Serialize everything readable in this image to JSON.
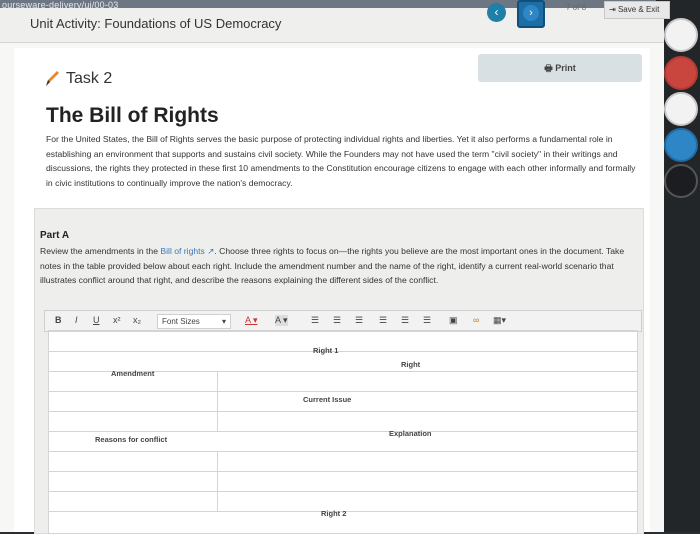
{
  "browser": {
    "strip_text": "ourseware-delivery/ui/00-03"
  },
  "header": {
    "unit_title": "Unit Activity: Foundations of US Democracy",
    "page_count": "7 of 8",
    "save_exit": "Save & Exit"
  },
  "task": {
    "label": "Task 2",
    "print_label": "Print",
    "title": "The Bill of Rights",
    "intro": "For the United States, the Bill of Rights serves the basic purpose of protecting individual rights and liberties. Yet it also performs a fundamental role in establishing an environment that supports and sustains civil society. While the Founders may not have used the term \"civil society\" in their writings and discussions, the rights they protected in these first 10 amendments to the Constitution encourage citizens to engage with each other informally and formally in civic institutions to continually improve the nation's democracy."
  },
  "part_a": {
    "title": "Part A",
    "text_before_link": "Review the amendments in the ",
    "link": "Bill of rights",
    "text_after_link": ". Choose three rights to focus on—the rights you believe are the most important ones in the document. Take notes in the table provided below about each right. Include the amendment number and the name of the right, identify a current real-world scenario that illustrates conflict around that right, and describe the reasons explaining the different sides of the conflict."
  },
  "toolbar": {
    "bold": "B",
    "italic": "I",
    "underline": "U",
    "superscript": "x²",
    "subscript": "x₂",
    "font_sizes": "Font Sizes"
  },
  "table": {
    "right1": "Right 1",
    "right": "Right",
    "amendment": "Amendment",
    "current_issue": "Current Issue",
    "explanation": "Explanation",
    "reasons": "Reasons for conflict",
    "right2": "Right 2"
  }
}
